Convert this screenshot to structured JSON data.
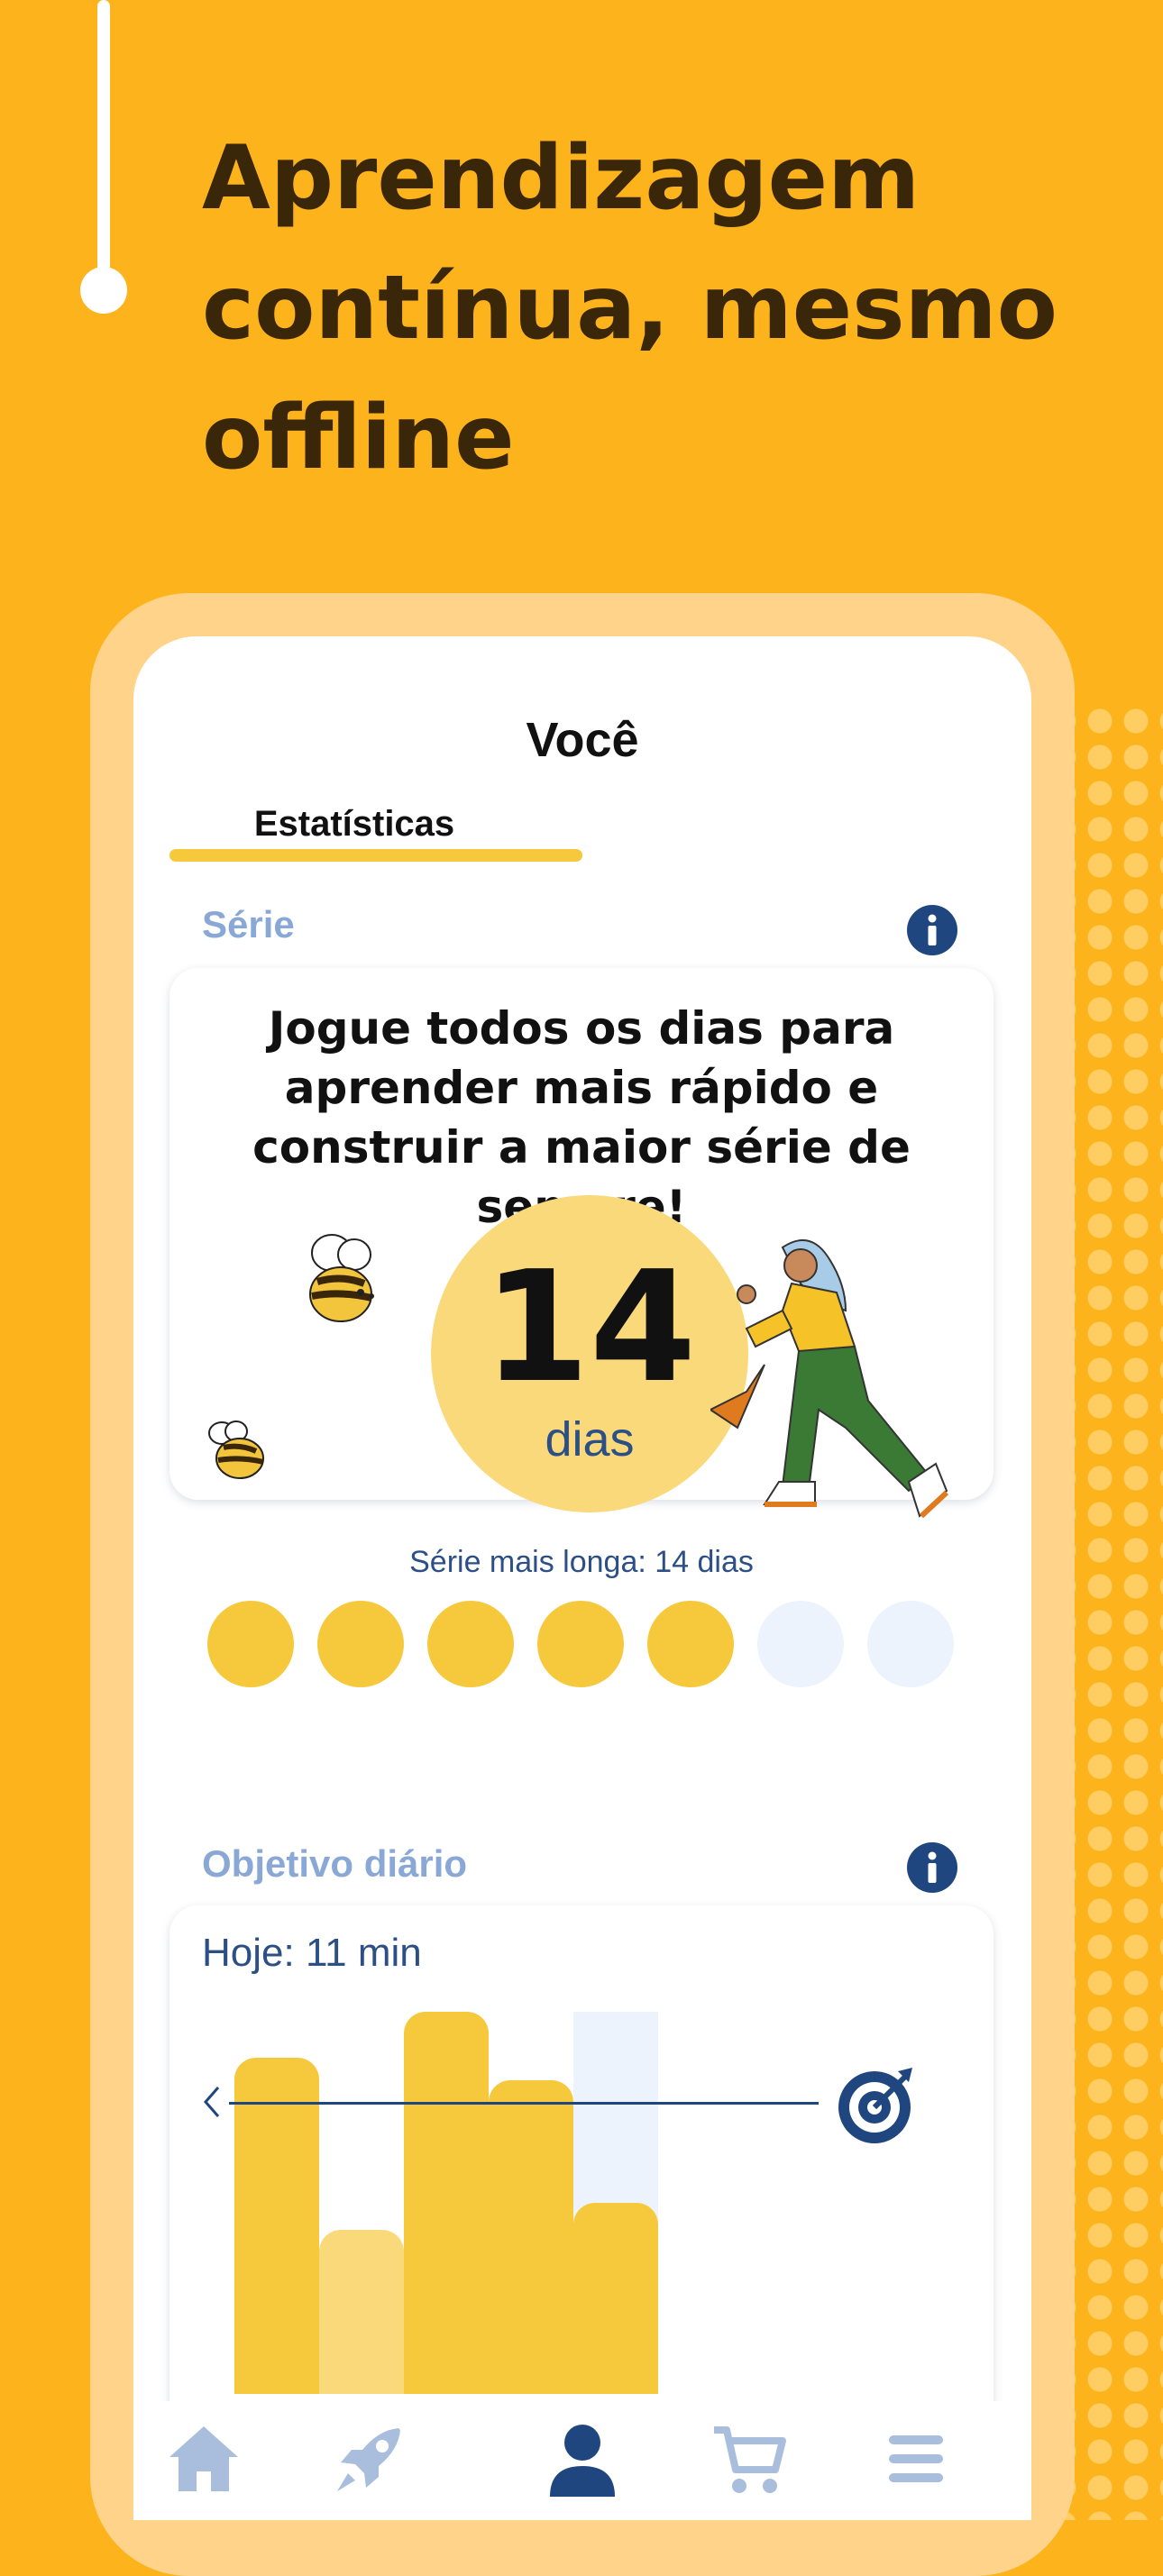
{
  "headline": "Aprendizagem contínua, mesmo offline",
  "screen": {
    "title": "Você",
    "tabs": [
      {
        "label": "Estatísticas",
        "active": true
      }
    ]
  },
  "streak": {
    "section_label": "Série",
    "message": "Jogue todos os dias para aprender mais rápido e construir a maior série de sempre!",
    "count": "14",
    "unit": "dias",
    "longest": "Série mais longa: 14 dias",
    "week_days_completed": [
      true,
      true,
      true,
      true,
      true,
      false,
      false
    ]
  },
  "daily_goal": {
    "section_label": "Objetivo diário",
    "today": "Hoje: 11 min",
    "bar_levels": [
      0.88,
      0.43,
      1.0,
      0.82,
      0.5
    ],
    "goal_level": 0.5,
    "today_index": 4
  },
  "bottom_nav": [
    {
      "icon": "home-icon",
      "active": false
    },
    {
      "icon": "rocket-icon",
      "active": false
    },
    {
      "icon": "profile-icon",
      "active": true
    },
    {
      "icon": "cart-icon",
      "active": false
    },
    {
      "icon": "menu-icon",
      "active": false
    }
  ],
  "colors": {
    "background": "#FDB31B",
    "accent_yellow": "#F6C93C",
    "navy": "#2C4F86",
    "muted_label": "#8AA8D6",
    "nav_inactive": "#A9BEDC",
    "nav_active": "#1F467F"
  }
}
